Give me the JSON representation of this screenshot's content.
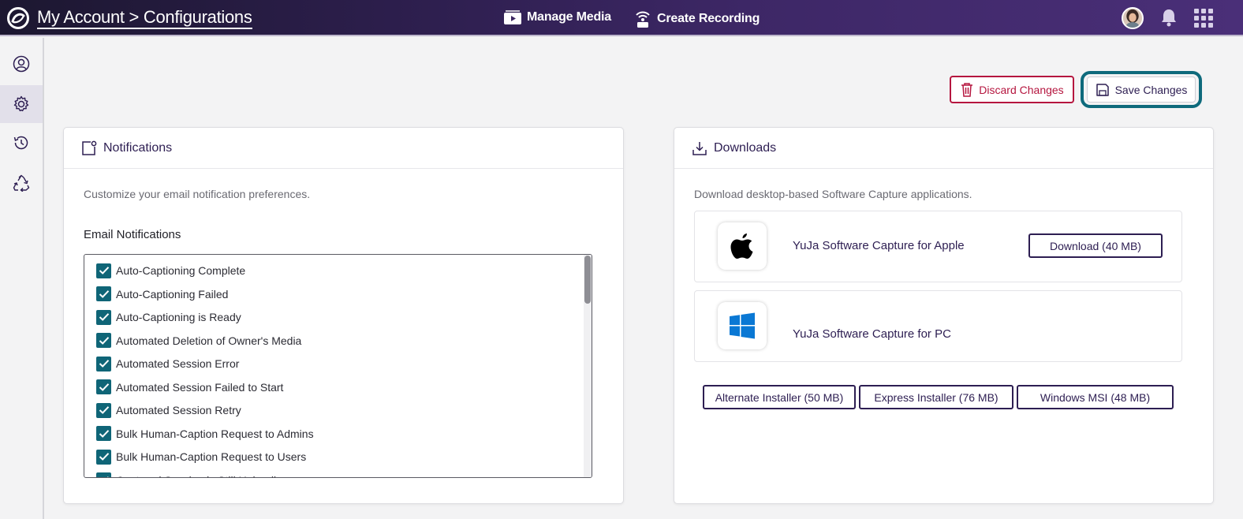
{
  "header": {
    "breadcrumb": "My Account > Configurations",
    "nav": [
      {
        "label": "Manage Media",
        "icon": "media-icon"
      },
      {
        "label": "Create Recording",
        "icon": "broadcast-icon"
      }
    ]
  },
  "sidebar": {
    "items": [
      {
        "icon": "user-circle-icon",
        "active": false
      },
      {
        "icon": "gear-icon",
        "active": true
      },
      {
        "icon": "history-icon",
        "active": false
      },
      {
        "icon": "recycle-icon",
        "active": false
      }
    ]
  },
  "actions": {
    "discard_label": "Discard Changes",
    "save_label": "Save Changes"
  },
  "notifications": {
    "title": "Notifications",
    "description": "Customize your email notification preferences.",
    "email_label": "Email Notifications",
    "items": [
      {
        "label": "Auto-Captioning Complete",
        "checked": true
      },
      {
        "label": "Auto-Captioning Failed",
        "checked": true
      },
      {
        "label": "Auto-Captioning is Ready",
        "checked": true
      },
      {
        "label": "Automated Deletion of Owner's Media",
        "checked": true
      },
      {
        "label": "Automated Session Error",
        "checked": true
      },
      {
        "label": "Automated Session Failed to Start",
        "checked": true
      },
      {
        "label": "Automated Session Retry",
        "checked": true
      },
      {
        "label": "Bulk Human-Caption Request to Admins",
        "checked": true
      },
      {
        "label": "Bulk Human-Caption Request to Users",
        "checked": true
      },
      {
        "label": "Captured Session is Still Uploading",
        "checked": true
      }
    ]
  },
  "downloads": {
    "title": "Downloads",
    "description": "Download desktop-based Software Capture applications.",
    "apps": [
      {
        "name": "YuJa Software Capture for Apple",
        "icon": "apple-icon",
        "button": "Download (40 MB)"
      },
      {
        "name": "YuJa Software Capture for PC",
        "icon": "windows-icon"
      }
    ],
    "pc_buttons": [
      "Alternate Installer (50 MB)",
      "Express Installer (76 MB)",
      "Windows MSI (48 MB)"
    ]
  },
  "colors": {
    "header_start": "#1c1730",
    "header_end": "#4a2f78",
    "accent_teal": "#0f6577",
    "discard_red": "#b5163f",
    "primary_text": "#2d1e52"
  }
}
